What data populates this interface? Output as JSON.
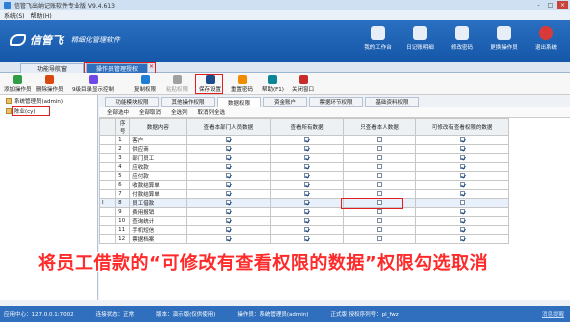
{
  "window": {
    "title": "信管飞出纳记账软件专业版 V9.4.613",
    "controls": [
      "-",
      "□",
      "×"
    ]
  },
  "menu": [
    "系统(S)",
    "帮助(H)"
  ],
  "banner": {
    "logo_name": "信管飞",
    "logo_sub": "精细化管理软件",
    "buttons": [
      {
        "label": "我的工作台",
        "icon": "dashboard-icon"
      },
      {
        "label": "日记账明细",
        "icon": "ledger-icon"
      },
      {
        "label": "修改密码",
        "icon": "lock-icon"
      },
      {
        "label": "更换操作员",
        "icon": "user-icon"
      },
      {
        "label": "退出系统",
        "icon": "power-icon"
      }
    ]
  },
  "tabs": [
    {
      "label": "功能导航窗"
    },
    {
      "label": "操作员管理授权",
      "active": true
    }
  ],
  "toolbar": [
    {
      "label": "添加操作员",
      "icon": "add-icon",
      "color": "#2f9e44"
    },
    {
      "label": "删除操作员",
      "icon": "delete-icon",
      "color": "#d9480f"
    },
    {
      "label": "9级目录显示控制",
      "icon": "tree-icon",
      "color": "#7048e8"
    },
    {
      "label": "复制权限",
      "icon": "copy-icon",
      "color": "#1c7ed6"
    },
    {
      "label": "粘贴权限",
      "icon": "paste-icon",
      "color": "#a0a0a0"
    },
    {
      "label": "保存设置",
      "icon": "save-icon",
      "color": "#1c4c8c"
    },
    {
      "label": "重置密码",
      "icon": "key-icon",
      "color": "#f08c00"
    },
    {
      "label": "帮助(F1)",
      "icon": "help-icon",
      "color": "#0c8599"
    },
    {
      "label": "关闭窗口",
      "icon": "close-window-icon",
      "color": "#c92a2a"
    }
  ],
  "tree": [
    {
      "label": "系统管理员(admin)"
    },
    {
      "label": "陈业(cy)"
    }
  ],
  "right_tabs": [
    "功能模块权限",
    "其他操作权限",
    "数据权限",
    "资金账户",
    "票据环节权限",
    "基础资料权限"
  ],
  "subbar": [
    "全部选中",
    "全部取消",
    "全选列",
    "取消列全选"
  ],
  "table": {
    "headers": [
      "序号",
      "数据内容",
      "查看本部门人员数据",
      "查看所有数据",
      "只查看本人数据",
      "可修改有查看权限的数据"
    ],
    "rows": [
      {
        "no": "1",
        "name": "客户",
        "c": [
          true,
          true,
          false,
          true
        ]
      },
      {
        "no": "2",
        "name": "供应商",
        "c": [
          true,
          true,
          false,
          true
        ]
      },
      {
        "no": "3",
        "name": "部门员工",
        "c": [
          true,
          true,
          false,
          true
        ]
      },
      {
        "no": "4",
        "name": "应收款",
        "c": [
          true,
          true,
          false,
          true
        ]
      },
      {
        "no": "5",
        "name": "应付款",
        "c": [
          true,
          true,
          false,
          true
        ]
      },
      {
        "no": "6",
        "name": "收款结算单",
        "c": [
          true,
          true,
          false,
          true
        ]
      },
      {
        "no": "7",
        "name": "付款结算单",
        "c": [
          true,
          true,
          false,
          true
        ]
      },
      {
        "no": "8",
        "name": "员工借款",
        "c": [
          true,
          true,
          false,
          false
        ]
      },
      {
        "no": "9",
        "name": "费用报销",
        "c": [
          true,
          true,
          false,
          true
        ]
      },
      {
        "no": "10",
        "name": "查询统计",
        "c": [
          true,
          true,
          false,
          true
        ]
      },
      {
        "no": "11",
        "name": "手机短信",
        "c": [
          true,
          true,
          false,
          true
        ]
      },
      {
        "no": "12",
        "name": "票据档案",
        "c": [
          true,
          true,
          false,
          true
        ]
      }
    ],
    "cursor_mark": "I"
  },
  "caption": "将员工借款的“可修改有查看权限的数据”权限勾选取消",
  "status": {
    "server": "应用中心：127.0.0.1:7002",
    "conn": "连接状态：正常",
    "edition": "版本：演示版(仅供使用)",
    "operator": "操作员：系统管理员(admin)",
    "license": "正式版  授权序列号：pl_fwz",
    "link": "消息提醒"
  },
  "colors": {
    "accent": "#2f6fbd",
    "highlight": "#e02020",
    "caption": "#ff2a2a"
  }
}
